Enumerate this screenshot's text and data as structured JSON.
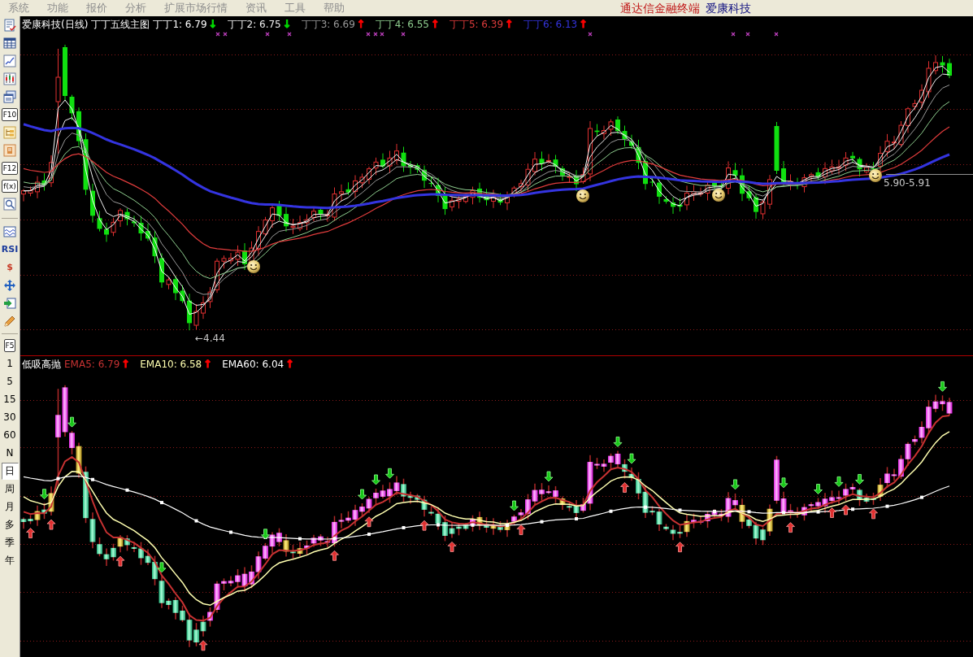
{
  "menu_bar": {
    "items": [
      "系统",
      "功能",
      "报价",
      "分析",
      "扩展市场行情",
      "资讯",
      "工具",
      "帮助"
    ],
    "app_name": "通达信金融终端",
    "stock_name": "爱康科技"
  },
  "toolbar": [
    {
      "kind": "icon"
    },
    {
      "kind": "icon"
    },
    {
      "kind": "icon"
    },
    {
      "kind": "icon"
    },
    {
      "kind": "icon"
    },
    {
      "kind": "key",
      "text": "F10"
    },
    {
      "kind": "icon"
    },
    {
      "kind": "icon"
    },
    {
      "kind": "key",
      "text": "F12"
    },
    {
      "kind": "key",
      "text": "f(x)"
    },
    {
      "kind": "icon"
    },
    {
      "kind": "separator"
    },
    {
      "kind": "icon"
    },
    {
      "kind": "text",
      "text": "RSI",
      "color": "#1c3c9c"
    },
    {
      "kind": "text",
      "text": "$",
      "color": "#c83c28"
    },
    {
      "kind": "icon"
    },
    {
      "kind": "icon"
    },
    {
      "kind": "icon"
    },
    {
      "kind": "separator"
    },
    {
      "kind": "key",
      "text": "F5"
    }
  ],
  "periods": [
    {
      "label": "1",
      "selected": false
    },
    {
      "label": "5",
      "selected": false
    },
    {
      "label": "15",
      "selected": false
    },
    {
      "label": "30",
      "selected": false
    },
    {
      "label": "60",
      "selected": false
    },
    {
      "label": "N",
      "selected": false
    },
    {
      "label": "日",
      "selected": true
    },
    {
      "label": "周",
      "selected": false
    },
    {
      "label": "月",
      "selected": false
    },
    {
      "label": "多",
      "selected": false
    },
    {
      "label": "季",
      "selected": false
    },
    {
      "label": "年",
      "selected": false
    }
  ],
  "main_chart": {
    "title": "爱康科技(日线)",
    "indicator": "丁丁五线主图",
    "lines": [
      {
        "label": "丁丁1: 6.79",
        "color": "#ffffff",
        "arrow": {
          "text": "↓",
          "color": "#00e000"
        }
      },
      {
        "label": "丁丁2: 6.75",
        "color": "#f0f0f0",
        "arrow": {
          "text": "↓",
          "color": "#00e000"
        }
      },
      {
        "label": "丁丁3: 6.69",
        "color": "#9a9a9a",
        "arrow": {
          "text": "↑",
          "color": "#ff0000"
        }
      },
      {
        "label": "丁丁4: 6.55",
        "color": "#90d090",
        "arrow": {
          "text": "↑",
          "color": "#ff0000"
        }
      },
      {
        "label": "丁丁5: 6.39",
        "color": "#e03c3c",
        "arrow": {
          "text": "↑",
          "color": "#ff0000"
        }
      },
      {
        "label": "丁丁6: 6.13",
        "color": "#3434e0",
        "arrow": {
          "text": "↑",
          "color": "#ff0000"
        }
      }
    ],
    "low_label": "←4.44",
    "range_label": "5.90-5.91"
  },
  "sub_chart": {
    "indicator": "低吸高抛",
    "lines": [
      {
        "label": "EMA5: 6.79",
        "color": "#c83232",
        "arrow": {
          "text": "↑",
          "color": "#ff0000"
        }
      },
      {
        "label": "EMA10: 6.58",
        "color": "#ffffb0",
        "arrow": {
          "text": "↑",
          "color": "#ff0000"
        }
      },
      {
        "label": "EMA60: 6.04",
        "color": "#ffffff",
        "arrow": {
          "text": "↑",
          "color": "#ff0000"
        }
      }
    ]
  }
}
